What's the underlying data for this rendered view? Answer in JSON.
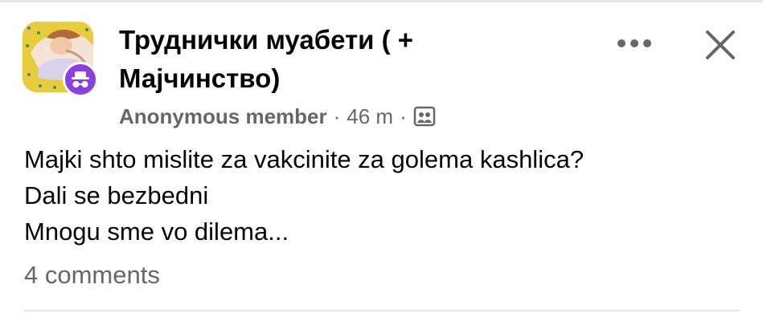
{
  "post": {
    "group_name": "Труднички муабети ( + Мајчинство)",
    "author": "Anonymous member",
    "separator": "·",
    "time": "46 m",
    "audience_icon": "group-audience-icon",
    "avatar_icon": "group-avatar",
    "anonymous_icon": "incognito-icon",
    "text_lines": [
      "Majki shto mislite za vakcinite za golema kashlica?",
      "Dali se bezbedni",
      "Mnogu sme vo dilema..."
    ],
    "comments": "4 comments"
  },
  "actions": {
    "more_icon": "more-icon",
    "close_icon": "close-icon"
  },
  "colors": {
    "text": "#050505",
    "secondary": "#65676b",
    "anon_badge": "#8a3fe0",
    "divider": "#e4e6ea"
  }
}
